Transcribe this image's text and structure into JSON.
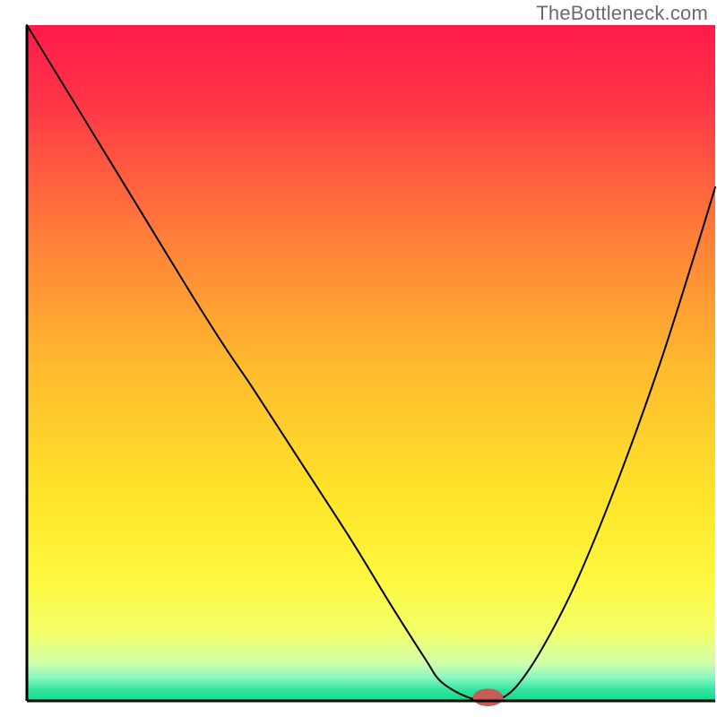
{
  "watermark": "TheBottleneck.com",
  "chart_data": {
    "type": "line",
    "title": "",
    "xlabel": "",
    "ylabel": "",
    "xlim": [
      0,
      100
    ],
    "ylim": [
      0,
      100
    ],
    "axes_visible": {
      "left": true,
      "bottom": true,
      "top": false,
      "right": false
    },
    "ticks_visible": false,
    "background_gradient_stops": [
      {
        "offset": 0.0,
        "color": "#ff1a4b"
      },
      {
        "offset": 0.12,
        "color": "#ff3747"
      },
      {
        "offset": 0.3,
        "color": "#ff7a3a"
      },
      {
        "offset": 0.5,
        "color": "#ffb92e"
      },
      {
        "offset": 0.7,
        "color": "#ffe52a"
      },
      {
        "offset": 0.82,
        "color": "#fff83e"
      },
      {
        "offset": 0.9,
        "color": "#f3ff6a"
      },
      {
        "offset": 0.945,
        "color": "#cfffad"
      },
      {
        "offset": 0.965,
        "color": "#8bf7c2"
      },
      {
        "offset": 0.985,
        "color": "#2de39b"
      },
      {
        "offset": 1.0,
        "color": "#17d88f"
      }
    ],
    "series": [
      {
        "name": "bottleneck-curve",
        "x": [
          0,
          6,
          12,
          18,
          24,
          29,
          33,
          40,
          47,
          53,
          58,
          60,
          63,
          66,
          68,
          71,
          75,
          80,
          86,
          92,
          97,
          100
        ],
        "y": [
          100,
          90,
          80,
          70,
          60,
          52,
          46,
          35,
          24,
          14,
          6,
          3,
          1,
          0,
          0,
          2,
          8,
          18,
          33,
          50,
          66,
          76
        ],
        "color": "#000000",
        "width": 2
      }
    ],
    "marker": {
      "name": "bottleneck-point",
      "x": 67,
      "y": 0.5,
      "rx": 2.2,
      "ry": 1.3,
      "fill": "#c85a5a"
    }
  }
}
